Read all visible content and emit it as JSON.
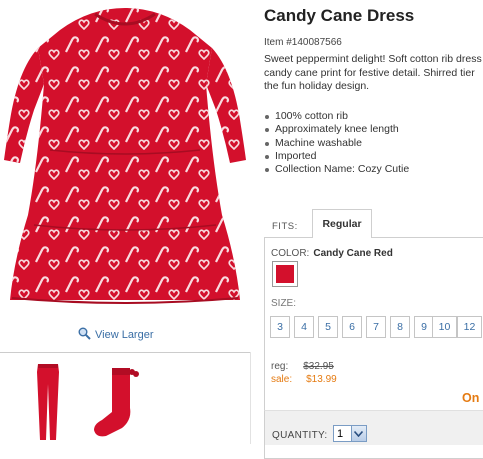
{
  "product": {
    "title": "Candy Cane Dress",
    "item_number": "Item #140087566",
    "description_lines": [
      "Sweet peppermint delight! Soft cotton rib dress",
      "candy cane print for festive detail. Shirred tier",
      "the fun holiday design."
    ],
    "features": [
      "100% cotton rib",
      "Approximately knee length",
      "Machine washable",
      "Imported",
      "Collection Name: Cozy Cutie"
    ]
  },
  "gallery": {
    "view_larger_label": "View Larger",
    "main_image_icon": "dress-image",
    "thumbnails": [
      "leggings-thumbnail",
      "socks-thumbnail"
    ]
  },
  "fit": {
    "label": "FITS:",
    "selected_tab": "Regular"
  },
  "color": {
    "label": "COLOR:",
    "value": "Candy Cane Red",
    "swatch_color": "#d3102c"
  },
  "size": {
    "label": "SIZE:",
    "options": [
      "3",
      "4",
      "5",
      "6",
      "7",
      "8",
      "9",
      "10",
      "12"
    ]
  },
  "price": {
    "reg_label": "reg:",
    "reg_value": "$32.95",
    "sale_label": "sale:",
    "sale_value": "$13.99",
    "cut_text": "On"
  },
  "quantity": {
    "label": "QUANTITY:",
    "value": "1"
  },
  "colors": {
    "dress_red": "#d3102c",
    "link_blue": "#3a6ea5",
    "sale_orange": "#e57b12"
  }
}
